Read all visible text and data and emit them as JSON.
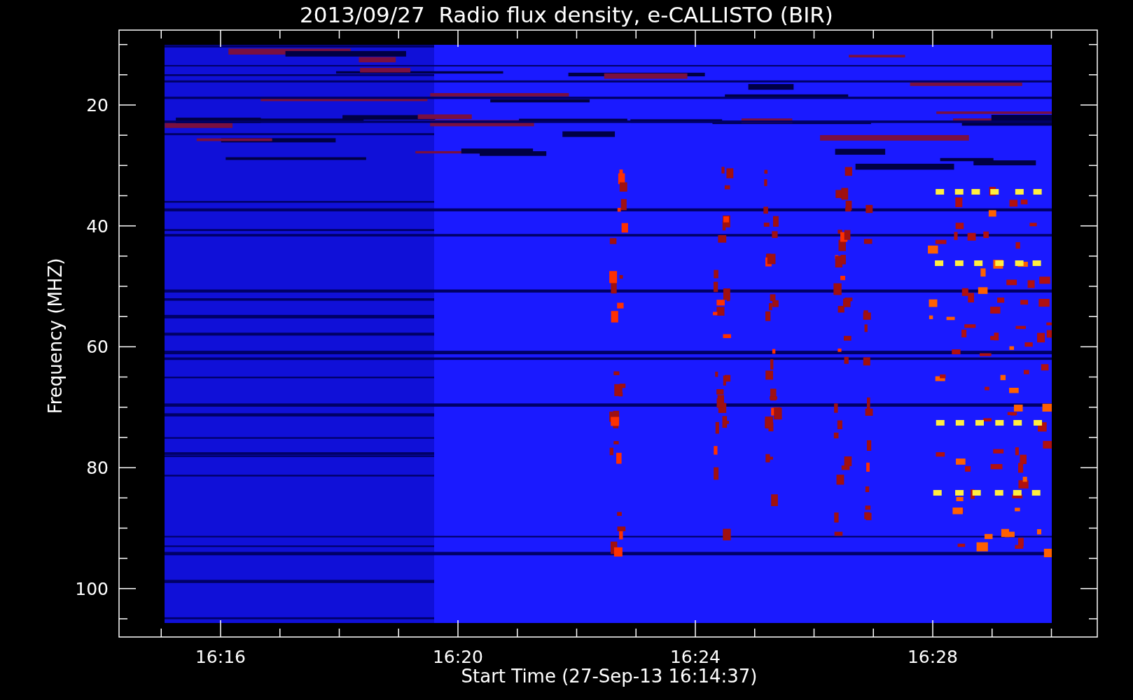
{
  "title": "2013/09/27  Radio flux density, e-CALLISTO (BIR)",
  "ylabel": "Frequency (MHZ)",
  "xlabel": "Start Time (27-Sep-13 16:14:37)",
  "yticks": [
    "20",
    "40",
    "60",
    "80",
    "100"
  ],
  "xticks": [
    "16:16",
    "16:20",
    "16:24",
    "16:28"
  ]
}
